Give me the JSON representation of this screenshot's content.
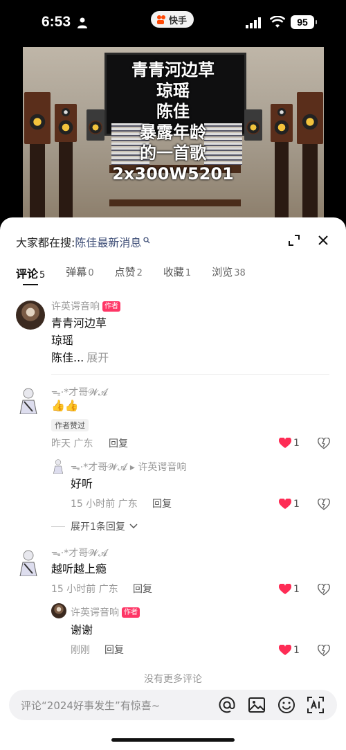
{
  "status_bar": {
    "time": "6:53",
    "app_name": "快手",
    "battery": "95"
  },
  "video": {
    "overlay_lines": [
      "青青河边草",
      "琼瑶",
      "陈佳",
      "暴露年龄",
      "的一首歌",
      "2x300W5201"
    ]
  },
  "search_hint": {
    "prefix": "大家都在搜:",
    "term": "陈佳最新消息"
  },
  "tabs": [
    {
      "label": "评论",
      "count": "5"
    },
    {
      "label": "弹幕",
      "count": "0"
    },
    {
      "label": "点赞",
      "count": "2"
    },
    {
      "label": "收藏",
      "count": "1"
    },
    {
      "label": "浏览",
      "count": "38"
    }
  ],
  "comments": {
    "c1": {
      "name": "许英谔音响",
      "tag": "作者",
      "lines": [
        "青青河边草",
        "琼瑶"
      ],
      "last_line": "陈佳...",
      "more": "展开"
    },
    "c2": {
      "name": "ᯓ·*才哥𝓦𝓐",
      "emoji": "👍👍",
      "badge": "作者赞过",
      "time_loc": "昨天 广东",
      "reply": "回复",
      "likes": "1"
    },
    "r1": {
      "name": "ᯓ·*才哥𝓦𝓐",
      "arrow": "▸",
      "to": "许英谔音响",
      "text": "好听",
      "time_loc": "15 小时前 广东",
      "reply": "回复",
      "likes": "1"
    },
    "expand_replies": "展开1条回复",
    "c3": {
      "name": "ᯓ·*才哥𝓦𝓐",
      "text": "越听越上瘾",
      "time_loc": "15 小时前 广东",
      "reply": "回复",
      "likes": "1"
    },
    "r2": {
      "name": "许英谔音响",
      "tag": "作者",
      "text": "谢谢",
      "time_loc": "刚刚",
      "reply": "回复",
      "likes": "1"
    }
  },
  "no_more": "没有更多评论",
  "input": {
    "placeholder": "评论“2024好事发生”有惊喜~"
  },
  "colors": {
    "accent_red": "#fe3666",
    "like_heart": "#fe2c55",
    "link_blue": "#3e4e77"
  }
}
